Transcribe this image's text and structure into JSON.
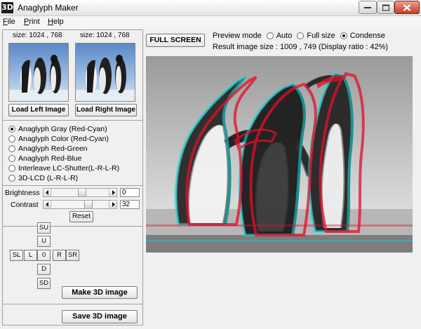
{
  "window": {
    "app_icon_text": "3D",
    "title": "Anaglyph Maker"
  },
  "menu": [
    "File",
    "Print",
    "Help"
  ],
  "left_image": {
    "size_label": "size: 1024 , 768",
    "load_button": "Load Left Image"
  },
  "right_image": {
    "size_label": "size: 1024 , 768",
    "load_button": "Load Right Image"
  },
  "modes": [
    {
      "label": "Anaglyph Gray (Red-Cyan)",
      "selected": true
    },
    {
      "label": "Anaglyph Color (Red-Cyan)",
      "selected": false
    },
    {
      "label": "Anaglyph Red-Green",
      "selected": false
    },
    {
      "label": "Anaglyph Red-Blue",
      "selected": false
    },
    {
      "label": "Interleave LC-Shutter(L-R-L-R)",
      "selected": false
    },
    {
      "label": "3D-LCD (L-R-L-R)",
      "selected": false
    }
  ],
  "brightness": {
    "label": "Brightness",
    "value": "0"
  },
  "contrast": {
    "label": "Contrast",
    "value": "32"
  },
  "reset_label": "Reset",
  "shift_buttons": {
    "su": "SU",
    "u": "U",
    "sl": "SL",
    "l": "L",
    "zero": "0",
    "r": "R",
    "sr": "SR",
    "d": "D",
    "sd": "SD"
  },
  "make_button": "Make 3D image",
  "save_button": "Save 3D image",
  "full_screen_button": "FULL SCREEN",
  "preview": {
    "label": "Preview mode",
    "options": [
      {
        "label": "Auto",
        "selected": false
      },
      {
        "label": "Full size",
        "selected": false
      },
      {
        "label": "Condense",
        "selected": true
      }
    ]
  },
  "result_text": "Result image size :  1009 , 749  (Display ratio : 42%)",
  "colors": {
    "window_bg": "#f0f0f0",
    "close_button": "#c43d22",
    "anaglyph_red": "#e0102a",
    "anaglyph_cyan": "#10e0e0"
  }
}
